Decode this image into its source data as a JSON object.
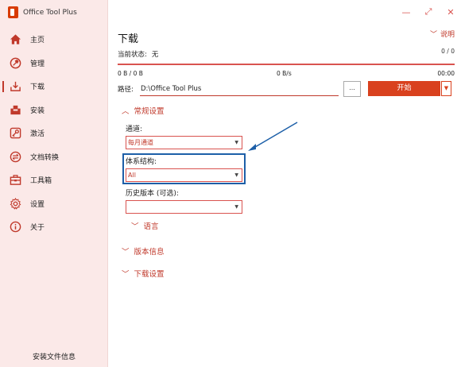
{
  "app": {
    "title": "Office Tool Plus"
  },
  "sidebar": {
    "items": [
      {
        "label": "主页",
        "icon": "home-icon"
      },
      {
        "label": "管理",
        "icon": "manage-icon"
      },
      {
        "label": "下载",
        "icon": "download-icon",
        "active": true
      },
      {
        "label": "安装",
        "icon": "install-icon"
      },
      {
        "label": "激活",
        "icon": "key-icon"
      },
      {
        "label": "文档转换",
        "icon": "convert-icon"
      },
      {
        "label": "工具箱",
        "icon": "toolbox-icon"
      },
      {
        "label": "设置",
        "icon": "gear-icon"
      },
      {
        "label": "关于",
        "icon": "info-icon"
      }
    ],
    "footer": "安装文件信息"
  },
  "window": {
    "minimize": "—",
    "restore": "⤢",
    "close": "✕"
  },
  "main": {
    "title": "下载",
    "help": "说明",
    "status_label": "当前状态:",
    "status_value": "无",
    "progress_count": "0 / 0",
    "bytes": "0 B / 0 B",
    "speed": "0 B/s",
    "time": "00:00",
    "path_label": "路径:",
    "path_value": "D:\\Office Tool Plus",
    "browse": "...",
    "start": "开始",
    "general_section": "常规设置",
    "channel_label": "通道:",
    "channel_value": "每月通道",
    "arch_label": "体系结构:",
    "arch_value": "All",
    "version_label": "历史版本 (可选):",
    "version_value": "",
    "language_section": "语言",
    "version_info_section": "版本信息",
    "download_settings_section": "下载设置"
  },
  "colors": {
    "accent": "#d9411e",
    "highlight": "#1d5fa8"
  }
}
